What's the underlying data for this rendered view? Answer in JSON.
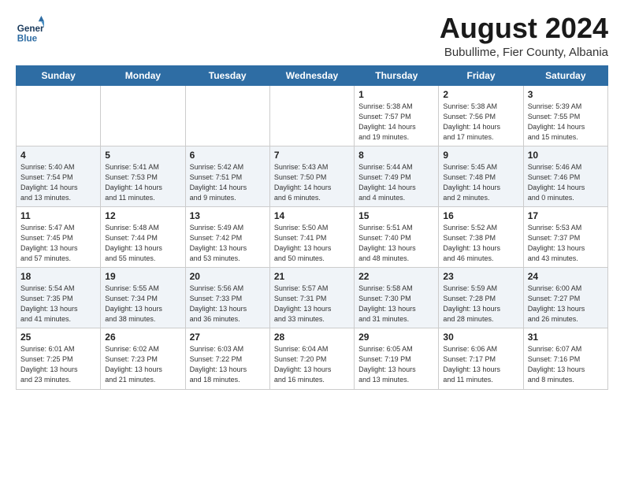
{
  "header": {
    "logo_line1": "General",
    "logo_line2": "Blue",
    "month_title": "August 2024",
    "subtitle": "Bubullime, Fier County, Albania"
  },
  "days_of_week": [
    "Sunday",
    "Monday",
    "Tuesday",
    "Wednesday",
    "Thursday",
    "Friday",
    "Saturday"
  ],
  "weeks": [
    [
      {
        "day": "",
        "info": ""
      },
      {
        "day": "",
        "info": ""
      },
      {
        "day": "",
        "info": ""
      },
      {
        "day": "",
        "info": ""
      },
      {
        "day": "1",
        "info": "Sunrise: 5:38 AM\nSunset: 7:57 PM\nDaylight: 14 hours\nand 19 minutes."
      },
      {
        "day": "2",
        "info": "Sunrise: 5:38 AM\nSunset: 7:56 PM\nDaylight: 14 hours\nand 17 minutes."
      },
      {
        "day": "3",
        "info": "Sunrise: 5:39 AM\nSunset: 7:55 PM\nDaylight: 14 hours\nand 15 minutes."
      }
    ],
    [
      {
        "day": "4",
        "info": "Sunrise: 5:40 AM\nSunset: 7:54 PM\nDaylight: 14 hours\nand 13 minutes."
      },
      {
        "day": "5",
        "info": "Sunrise: 5:41 AM\nSunset: 7:53 PM\nDaylight: 14 hours\nand 11 minutes."
      },
      {
        "day": "6",
        "info": "Sunrise: 5:42 AM\nSunset: 7:51 PM\nDaylight: 14 hours\nand 9 minutes."
      },
      {
        "day": "7",
        "info": "Sunrise: 5:43 AM\nSunset: 7:50 PM\nDaylight: 14 hours\nand 6 minutes."
      },
      {
        "day": "8",
        "info": "Sunrise: 5:44 AM\nSunset: 7:49 PM\nDaylight: 14 hours\nand 4 minutes."
      },
      {
        "day": "9",
        "info": "Sunrise: 5:45 AM\nSunset: 7:48 PM\nDaylight: 14 hours\nand 2 minutes."
      },
      {
        "day": "10",
        "info": "Sunrise: 5:46 AM\nSunset: 7:46 PM\nDaylight: 14 hours\nand 0 minutes."
      }
    ],
    [
      {
        "day": "11",
        "info": "Sunrise: 5:47 AM\nSunset: 7:45 PM\nDaylight: 13 hours\nand 57 minutes."
      },
      {
        "day": "12",
        "info": "Sunrise: 5:48 AM\nSunset: 7:44 PM\nDaylight: 13 hours\nand 55 minutes."
      },
      {
        "day": "13",
        "info": "Sunrise: 5:49 AM\nSunset: 7:42 PM\nDaylight: 13 hours\nand 53 minutes."
      },
      {
        "day": "14",
        "info": "Sunrise: 5:50 AM\nSunset: 7:41 PM\nDaylight: 13 hours\nand 50 minutes."
      },
      {
        "day": "15",
        "info": "Sunrise: 5:51 AM\nSunset: 7:40 PM\nDaylight: 13 hours\nand 48 minutes."
      },
      {
        "day": "16",
        "info": "Sunrise: 5:52 AM\nSunset: 7:38 PM\nDaylight: 13 hours\nand 46 minutes."
      },
      {
        "day": "17",
        "info": "Sunrise: 5:53 AM\nSunset: 7:37 PM\nDaylight: 13 hours\nand 43 minutes."
      }
    ],
    [
      {
        "day": "18",
        "info": "Sunrise: 5:54 AM\nSunset: 7:35 PM\nDaylight: 13 hours\nand 41 minutes."
      },
      {
        "day": "19",
        "info": "Sunrise: 5:55 AM\nSunset: 7:34 PM\nDaylight: 13 hours\nand 38 minutes."
      },
      {
        "day": "20",
        "info": "Sunrise: 5:56 AM\nSunset: 7:33 PM\nDaylight: 13 hours\nand 36 minutes."
      },
      {
        "day": "21",
        "info": "Sunrise: 5:57 AM\nSunset: 7:31 PM\nDaylight: 13 hours\nand 33 minutes."
      },
      {
        "day": "22",
        "info": "Sunrise: 5:58 AM\nSunset: 7:30 PM\nDaylight: 13 hours\nand 31 minutes."
      },
      {
        "day": "23",
        "info": "Sunrise: 5:59 AM\nSunset: 7:28 PM\nDaylight: 13 hours\nand 28 minutes."
      },
      {
        "day": "24",
        "info": "Sunrise: 6:00 AM\nSunset: 7:27 PM\nDaylight: 13 hours\nand 26 minutes."
      }
    ],
    [
      {
        "day": "25",
        "info": "Sunrise: 6:01 AM\nSunset: 7:25 PM\nDaylight: 13 hours\nand 23 minutes."
      },
      {
        "day": "26",
        "info": "Sunrise: 6:02 AM\nSunset: 7:23 PM\nDaylight: 13 hours\nand 21 minutes."
      },
      {
        "day": "27",
        "info": "Sunrise: 6:03 AM\nSunset: 7:22 PM\nDaylight: 13 hours\nand 18 minutes."
      },
      {
        "day": "28",
        "info": "Sunrise: 6:04 AM\nSunset: 7:20 PM\nDaylight: 13 hours\nand 16 minutes."
      },
      {
        "day": "29",
        "info": "Sunrise: 6:05 AM\nSunset: 7:19 PM\nDaylight: 13 hours\nand 13 minutes."
      },
      {
        "day": "30",
        "info": "Sunrise: 6:06 AM\nSunset: 7:17 PM\nDaylight: 13 hours\nand 11 minutes."
      },
      {
        "day": "31",
        "info": "Sunrise: 6:07 AM\nSunset: 7:16 PM\nDaylight: 13 hours\nand 8 minutes."
      }
    ]
  ]
}
